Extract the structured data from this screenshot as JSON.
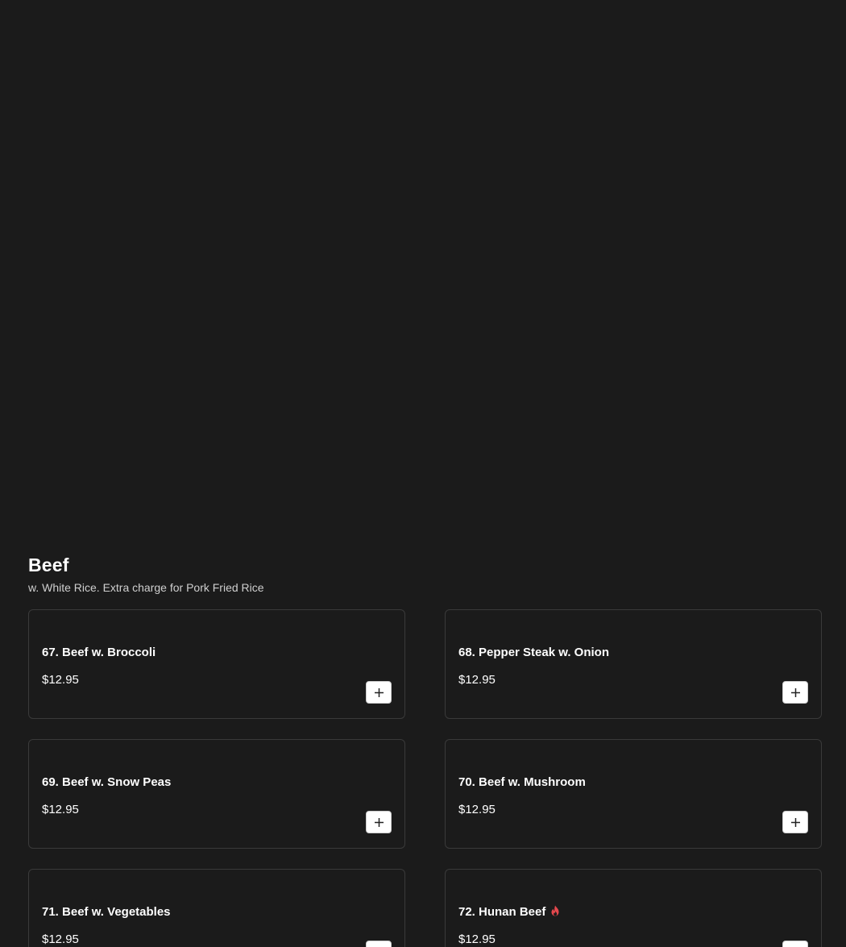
{
  "section": {
    "title": "Beef",
    "subtitle": "w. White Rice. Extra charge for Pork Fried Rice"
  },
  "items": [
    {
      "name": "67. Beef w. Broccoli",
      "price": "$12.95",
      "spicy": false
    },
    {
      "name": "68. Pepper Steak w. Onion",
      "price": "$12.95",
      "spicy": false
    },
    {
      "name": "69. Beef w. Snow Peas",
      "price": "$12.95",
      "spicy": false
    },
    {
      "name": "70. Beef w. Mushroom",
      "price": "$12.95",
      "spicy": false
    },
    {
      "name": "71. Beef w. Vegetables",
      "price": "$12.95",
      "spicy": false
    },
    {
      "name": "72. Hunan Beef",
      "price": "$12.95",
      "spicy": true
    }
  ],
  "icons": {
    "add": "plus-icon",
    "spicy": "flame-icon"
  },
  "colors": {
    "background": "#1b1b1b",
    "card_border": "#3a3a3a",
    "spicy": "#e5484d",
    "add_button": "#ffffff"
  }
}
